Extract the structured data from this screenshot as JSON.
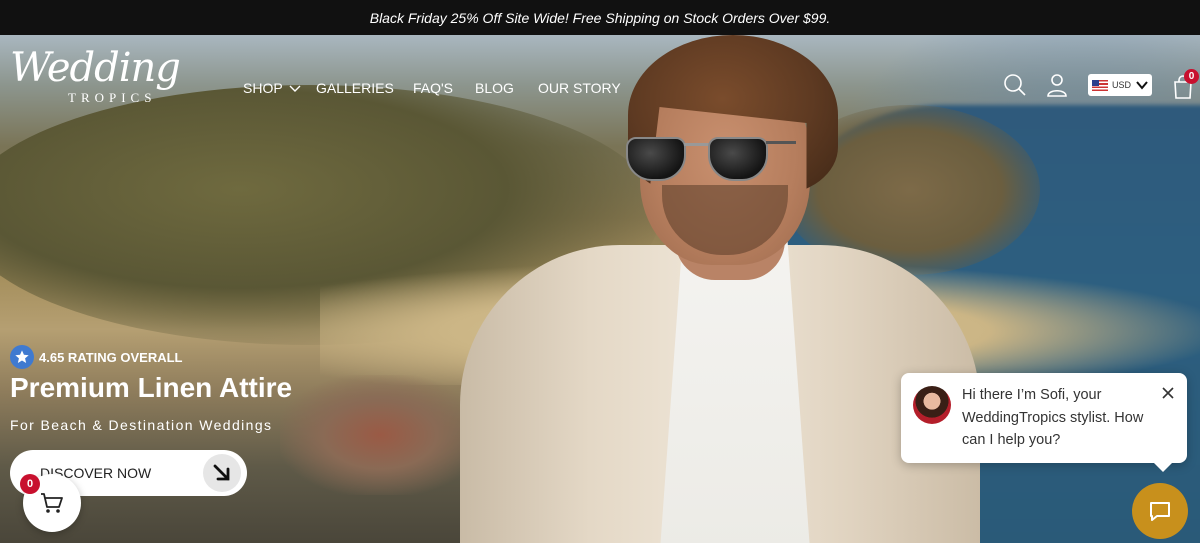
{
  "promo": {
    "text": "Black Friday 25% Off Site Wide! Free Shipping on Stock Orders Over $99."
  },
  "logo": {
    "script": "Wedding",
    "sub": "TROPICS"
  },
  "nav": {
    "items": [
      {
        "label": "SHOP"
      },
      {
        "label": "GALLERIES"
      },
      {
        "label": "FAQ's"
      },
      {
        "label": "BLOG"
      },
      {
        "label": "OUR STORY"
      }
    ]
  },
  "header": {
    "currency": "USD",
    "cart_count": "0"
  },
  "hero": {
    "rating": "4.65 RATING OVERALL",
    "title": "Premium Linen Attire",
    "subtitle": "For Beach & Destination Weddings",
    "cta": "DISCOVER NOW"
  },
  "floating_cart": {
    "count": "0"
  },
  "chat": {
    "message": "Hi there I’m Sofi, your WeddingTropics stylist. How can I help you?"
  },
  "colors": {
    "promo_bg": "#111111",
    "cart_badge": "#c8102e",
    "rating_badge": "#3f7ad0",
    "chat_launcher": "#c8901c"
  }
}
